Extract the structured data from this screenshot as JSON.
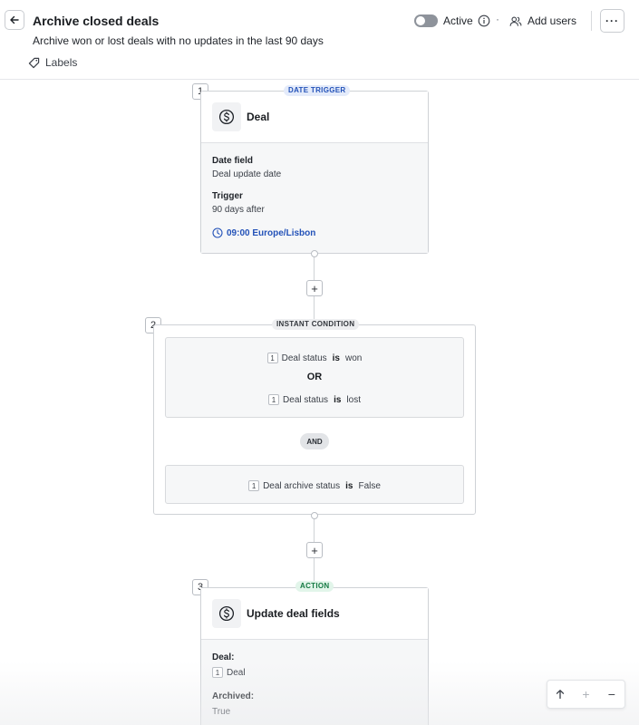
{
  "header": {
    "title": "Archive closed deals",
    "subtitle": "Archive won or lost deals with no updates in the last 90 days",
    "labels_label": "Labels",
    "active_label": "Active",
    "dot": "·",
    "add_users_label": "Add users",
    "more_label": "···",
    "toggle_on": false
  },
  "steps": [
    {
      "number": "1",
      "badge": "DATE TRIGGER",
      "entity": "Deal",
      "fields": [
        {
          "label": "Date field",
          "value": "Deal update date"
        },
        {
          "label": "Trigger",
          "value": "90 days after"
        }
      ],
      "time": "09:00 Europe/Lisbon"
    },
    {
      "number": "2",
      "badge": "INSTANT CONDITION",
      "groups": [
        {
          "conditions": [
            {
              "ref": "1",
              "field": "Deal status",
              "op": "is",
              "value": "won"
            },
            {
              "ref": "1",
              "field": "Deal status",
              "op": "is",
              "value": "lost"
            }
          ],
          "joiner": "OR"
        },
        {
          "conditions": [
            {
              "ref": "1",
              "field": "Deal archive status",
              "op": "is",
              "value": "False"
            }
          ]
        }
      ],
      "group_joiner": "AND"
    },
    {
      "number": "3",
      "badge": "ACTION",
      "entity": "Update deal fields",
      "fields": [
        {
          "label": "Deal:",
          "ref": "1",
          "value": "Deal"
        },
        {
          "label": "Archived:",
          "value": "True"
        }
      ]
    }
  ],
  "add_step_label": "+",
  "zoom": {
    "up": "↑",
    "in": "+",
    "out": "−"
  },
  "colors": {
    "accent_blue": "#2352b8",
    "action_green": "#157a43",
    "toggle_off": "#8e939b"
  },
  "icons": [
    "arrow-left-icon",
    "tag-icon",
    "info-icon",
    "users-icon",
    "dollar-circle-icon",
    "clock-icon",
    "arrow-up-icon"
  ]
}
